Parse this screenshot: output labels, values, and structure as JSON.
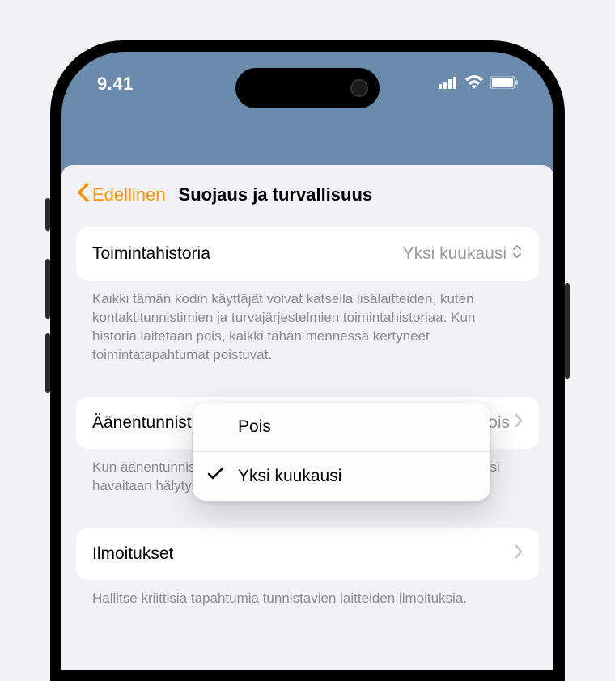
{
  "status": {
    "time": "9.41"
  },
  "nav": {
    "back": "Edellinen",
    "title": "Suojaus ja turvallisuus"
  },
  "rows": {
    "activity": {
      "label": "Toimintahistoria",
      "value": "Yksi kuukausi",
      "footer": "Kaikki tämän kodin käyttäjät voivat katsella lisälaitteiden, kuten kontaktitunnistimien ja turvajärjestelmien toimintahistoriaa. Kun historia laitetaan pois, kaikki tähän mennessä kertyneet toimintatapahtumat poistuvat."
    },
    "sound": {
      "label": "Äänentunnistus",
      "value": "Pois",
      "footer": "Kun äänentunnistus on käytössä, HomePod ilmoittaa, kun kotonasi havaitaan hälytysääni."
    },
    "notifications": {
      "label": "Ilmoitukset",
      "footer": "Hallitse kriittisiä tapahtumia tunnistavien laitteiden ilmoituksia."
    }
  },
  "dropdown": {
    "options": [
      {
        "label": "Pois",
        "selected": false
      },
      {
        "label": "Yksi kuukausi",
        "selected": true
      }
    ]
  }
}
